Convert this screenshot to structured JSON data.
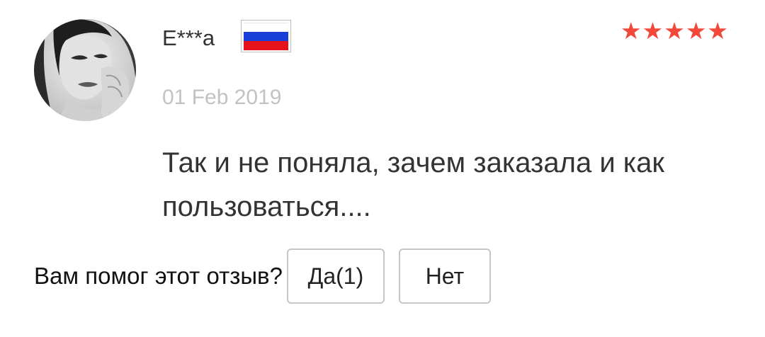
{
  "review": {
    "author": "E***a",
    "country_flag": "russia-flag-icon",
    "rating": 5,
    "rating_max": 5,
    "star_color": "#f2483a",
    "date": "01 Feb 2019",
    "text": "Так и не поняла, зачем заказала и как пользоваться...."
  },
  "helpful": {
    "question": "Вам помог этот отзыв?",
    "yes_label": "Да(1)",
    "no_label": "Нет"
  },
  "icons": {
    "avatar": "user-avatar-photo",
    "star": "star-icon"
  }
}
